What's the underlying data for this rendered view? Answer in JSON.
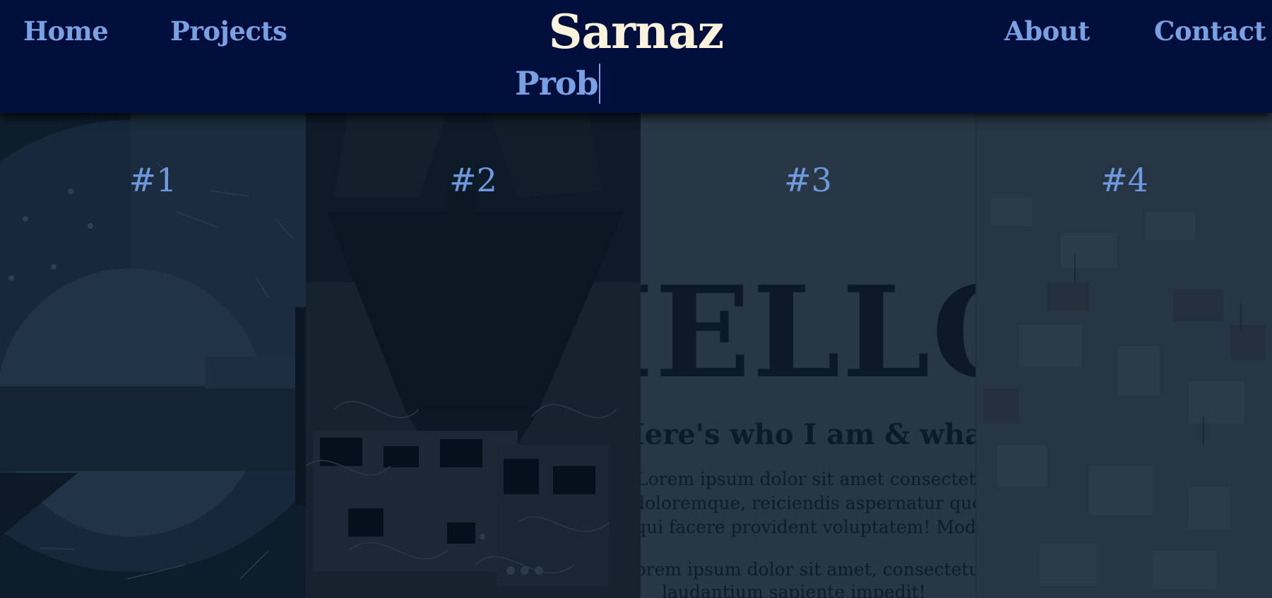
{
  "header": {
    "brand": "Sarnaz",
    "typed_text": "Prob",
    "nav": {
      "home": "Home",
      "projects": "Projects",
      "about": "About",
      "contact": "Contact"
    }
  },
  "panels": [
    {
      "label": "#1"
    },
    {
      "label": "#2"
    },
    {
      "label": "#3"
    },
    {
      "label": "#4"
    }
  ],
  "preview_3": {
    "heading": "HELLO",
    "subheading": "Here's who I am & what I do",
    "lines": [
      "Lorem ipsum dolor sit amet consectetur adipisicing elit. Minus,",
      "doloremque, reiciendis aspernatur quod aperiosam ex voluptate aliquid laborum,",
      "qui facere provident voluptatem! Modi dolor nam numquam? Temporibus",
      "Lorem ipsum dolor sit amet, consectetur adipisicing elit. Natus",
      "laudantium sapiente impedit!"
    ]
  },
  "colors": {
    "header_bg": "#000e3c",
    "nav_link": "#7aa0e4",
    "brand": "#fbf3dc",
    "panel_number": "#6f99df"
  }
}
